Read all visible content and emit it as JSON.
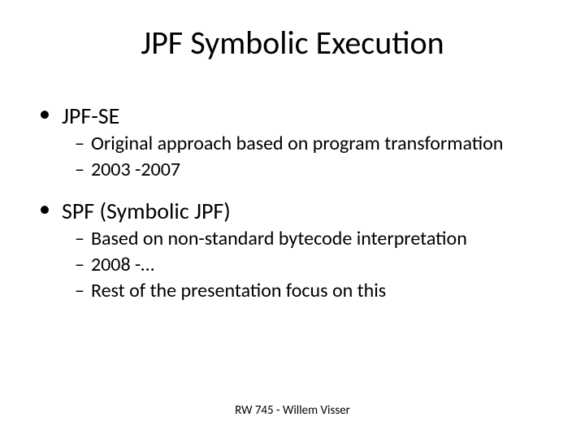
{
  "title": "JPF Symbolic Execution",
  "sections": [
    {
      "heading": "JPF-SE",
      "items": [
        "Original approach based on program transformation",
        "2003 -2007"
      ]
    },
    {
      "heading": "SPF (Symbolic JPF)",
      "items": [
        "Based on non-standard bytecode interpretation",
        "2008 -…",
        "Rest of the presentation focus on this"
      ]
    }
  ],
  "footer": "RW 745 - Willem Visser"
}
